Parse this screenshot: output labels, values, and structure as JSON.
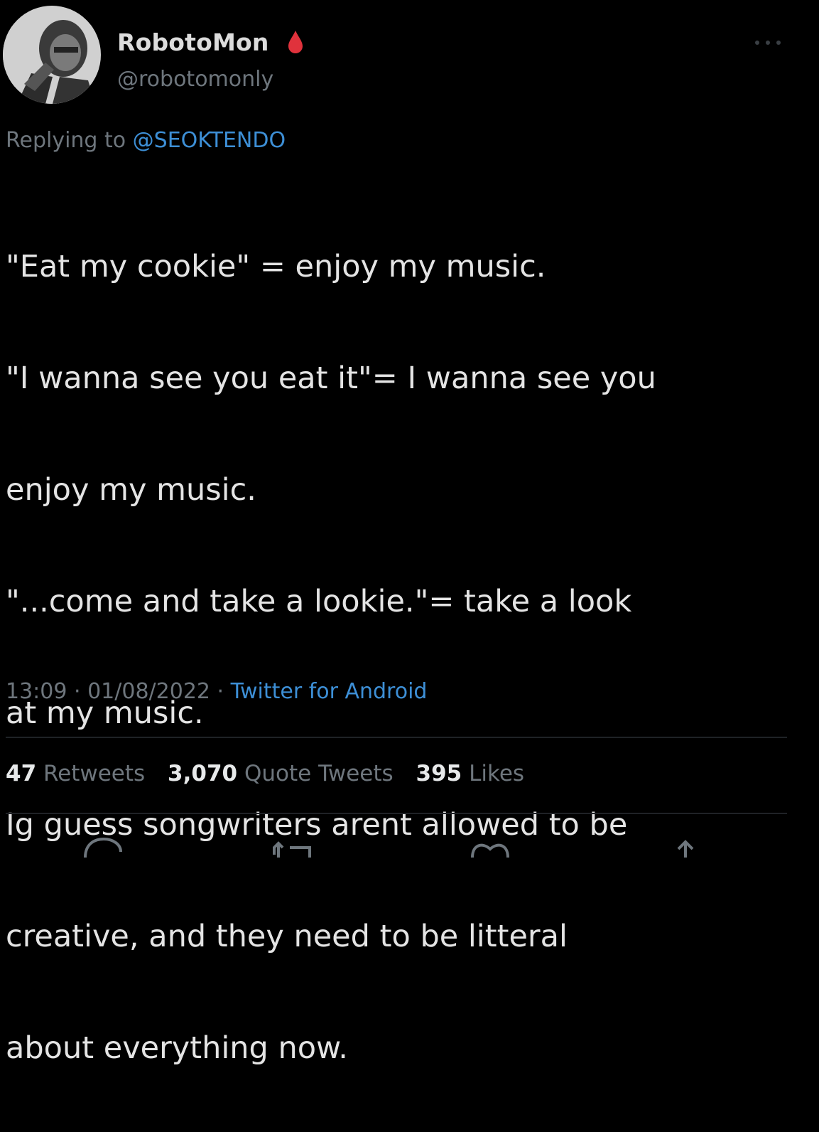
{
  "author": {
    "display_name": "RobotoMon",
    "handle": "@robotomonly",
    "avatar_icon": "avatar-photo",
    "badge_icon": "red-drop-icon"
  },
  "reply": {
    "prefix": "Replying to ",
    "mention": "@SEOKTENDO"
  },
  "tweet": {
    "lines": [
      "\"Eat my cookie\" = enjoy my music.",
      "\"I wanna see you eat it\"= I wanna see you",
      "enjoy my music.",
      "\"...come and take a lookie.\"= take a look",
      "at my music.",
      "Ig guess songwriters arent allowed to be",
      "creative, and they need to be litteral",
      "about everything now."
    ]
  },
  "meta": {
    "time": "13:09",
    "separator": " · ",
    "date": "01/08/2022",
    "source": "Twitter for Android"
  },
  "stats": {
    "retweets_count": "47",
    "retweets_label": "Retweets",
    "quotes_count": "3,070",
    "quotes_label": "Quote Tweets",
    "likes_count": "395",
    "likes_label": "Likes"
  },
  "colors": {
    "background": "#000000",
    "link": "#3d8fd6",
    "muted": "#6e767d",
    "text": "#e4e4e4",
    "badge": "#e0323c"
  }
}
